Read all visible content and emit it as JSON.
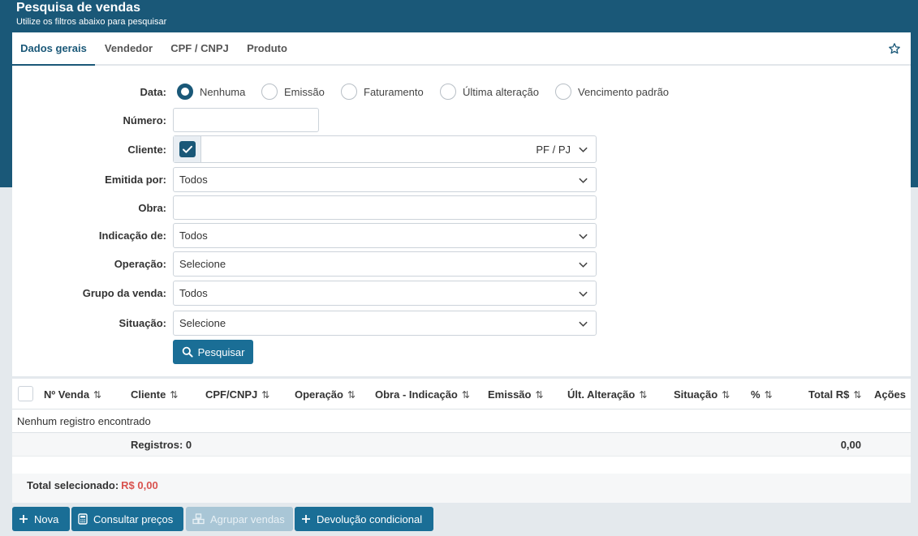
{
  "header": {
    "title": "Pesquisa de vendas",
    "subtitle": "Utilize os filtros abaixo para pesquisar"
  },
  "tabs": [
    {
      "label": "Dados gerais",
      "active": true
    },
    {
      "label": "Vendedor",
      "active": false
    },
    {
      "label": "CPF / CNPJ",
      "active": false
    },
    {
      "label": "Produto",
      "active": false
    }
  ],
  "form": {
    "data_label": "Data:",
    "date_options": [
      {
        "label": "Nenhuma",
        "checked": true
      },
      {
        "label": "Emissão",
        "checked": false
      },
      {
        "label": "Faturamento",
        "checked": false
      },
      {
        "label": "Última alteração",
        "checked": false
      },
      {
        "label": "Vencimento padrão",
        "checked": false
      }
    ],
    "numero_label": "Número:",
    "numero_value": "",
    "cliente_label": "Cliente:",
    "cliente_value": "",
    "cliente_type": "PF / PJ",
    "emitida_label": "Emitida por:",
    "emitida_value": "Todos",
    "obra_label": "Obra:",
    "obra_value": "",
    "indicacao_label": "Indicação de:",
    "indicacao_value": "Todos",
    "operacao_label": "Operação:",
    "operacao_value": "Selecione",
    "grupo_label": "Grupo da venda:",
    "grupo_value": "Todos",
    "situacao_label": "Situação:",
    "situacao_value": "Selecione",
    "search_button": "Pesquisar"
  },
  "table": {
    "columns": [
      "Nº Venda",
      "Cliente",
      "CPF/CNPJ",
      "Operação",
      "Obra - Indicação",
      "Emissão",
      "Últ. Alteração",
      "Situação",
      "%",
      "Total R$",
      "Ações"
    ],
    "sort_glyph": "⇅",
    "empty_text": "Nenhum registro encontrado",
    "registros": "Registros: 0",
    "total": "0,00",
    "total_selecionado_label": "Total selecionado:",
    "total_selecionado_value": "R$ 0,00"
  },
  "actions": {
    "nova": "Nova",
    "consultar": "Consultar preços",
    "agrupar": "Agrupar vendas",
    "devolucao": "Devolução condicional"
  },
  "colors": {
    "primary": "#1a5878",
    "button": "#1a6e96",
    "danger": "#d9534f"
  }
}
